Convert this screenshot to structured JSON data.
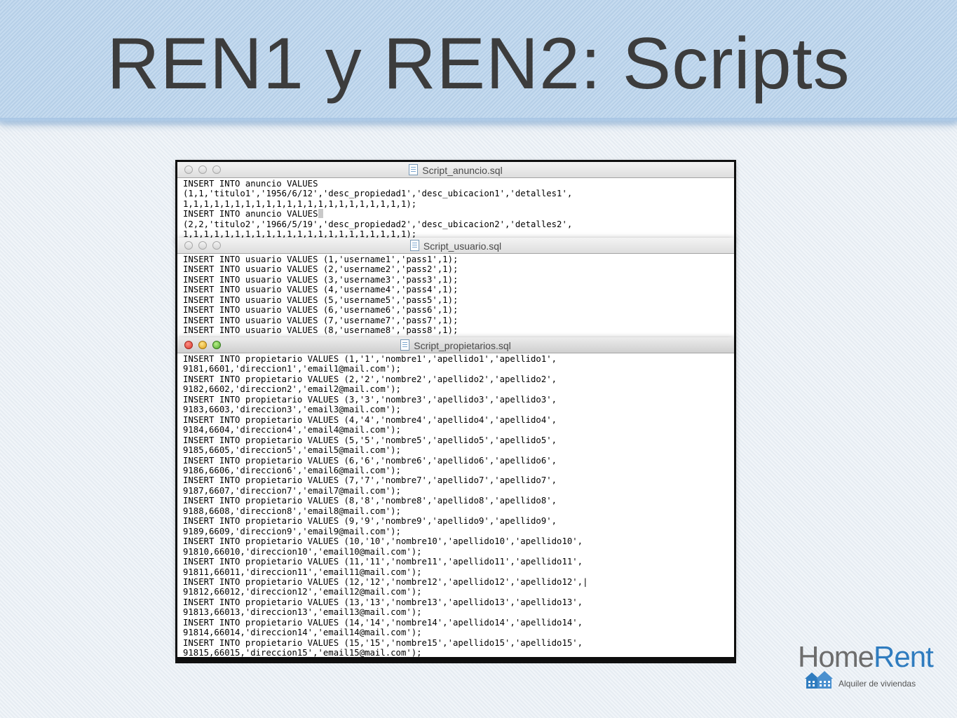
{
  "slide": {
    "title": "REN1 y REN2: Scripts"
  },
  "windows": [
    {
      "title": "Script_anuncio.sql",
      "active": false,
      "lines": [
        "INSERT INTO anuncio VALUES",
        "(1,1,'titulo1','1956/6/12','desc_propiedad1','desc_ubicacion1','detalles1',",
        "1,1,1,1,1,1,1,1,1,1,1,1,1,1,1,1,1,1,1,1,1,1);",
        "INSERT INTO anuncio VALUES",
        "(2,2,'titulo2','1966/5/19','desc_propiedad2','desc_ubicacion2','detalles2',",
        "1,1,1,1,1,1,1,1,1,1,1,1,1,1,1,1,1,1,1,1,1,1);"
      ]
    },
    {
      "title": "Script_usuario.sql",
      "active": false,
      "lines": [
        "INSERT INTO usuario VALUES (1,'username1','pass1',1);",
        "INSERT INTO usuario VALUES (2,'username2','pass2',1);",
        "INSERT INTO usuario VALUES (3,'username3','pass3',1);",
        "INSERT INTO usuario VALUES (4,'username4','pass4',1);",
        "INSERT INTO usuario VALUES (5,'username5','pass5',1);",
        "INSERT INTO usuario VALUES (6,'username6','pass6',1);",
        "INSERT INTO usuario VALUES (7,'username7','pass7',1);",
        "INSERT INTO usuario VALUES (8,'username8','pass8',1);"
      ]
    },
    {
      "title": "Script_propietarios.sql",
      "active": true,
      "lines": [
        "INSERT INTO propietario VALUES (1,'1','nombre1','apellido1','apellido1',",
        "9181,6601,'direccion1','email1@mail.com');",
        "INSERT INTO propietario VALUES (2,'2','nombre2','apellido2','apellido2',",
        "9182,6602,'direccion2','email2@mail.com');",
        "INSERT INTO propietario VALUES (3,'3','nombre3','apellido3','apellido3',",
        "9183,6603,'direccion3','email3@mail.com');",
        "INSERT INTO propietario VALUES (4,'4','nombre4','apellido4','apellido4',",
        "9184,6604,'direccion4','email4@mail.com');",
        "INSERT INTO propietario VALUES (5,'5','nombre5','apellido5','apellido5',",
        "9185,6605,'direccion5','email5@mail.com');",
        "INSERT INTO propietario VALUES (6,'6','nombre6','apellido6','apellido6',",
        "9186,6606,'direccion6','email6@mail.com');",
        "INSERT INTO propietario VALUES (7,'7','nombre7','apellido7','apellido7',",
        "9187,6607,'direccion7','email7@mail.com');",
        "INSERT INTO propietario VALUES (8,'8','nombre8','apellido8','apellido8',",
        "9188,6608,'direccion8','email8@mail.com');",
        "INSERT INTO propietario VALUES (9,'9','nombre9','apellido9','apellido9',",
        "9189,6609,'direccion9','email9@mail.com');",
        "INSERT INTO propietario VALUES (10,'10','nombre10','apellido10','apellido10',",
        "91810,66010,'direccion10','email10@mail.com');",
        "INSERT INTO propietario VALUES (11,'11','nombre11','apellido11','apellido11',",
        "91811,66011,'direccion11','email11@mail.com');",
        "INSERT INTO propietario VALUES (12,'12','nombre12','apellido12','apellido12',",
        "91812,66012,'direccion12','email12@mail.com');",
        "INSERT INTO propietario VALUES (13,'13','nombre13','apellido13','apellido13',",
        "91813,66013,'direccion13','email13@mail.com');",
        "INSERT INTO propietario VALUES (14,'14','nombre14','apellido14','apellido14',",
        "91814,66014,'direccion14','email14@mail.com');",
        "INSERT INTO propietario VALUES (15,'15','nombre15','apellido15','apellido15',",
        "91815,66015,'direccion15','email15@mail.com');"
      ]
    }
  ],
  "logo": {
    "brand_part1": "Home",
    "brand_part2": "Rent",
    "tagline": "Alquiler de viviendas",
    "colors": {
      "home": "#6d6d6d",
      "rent": "#2f7cbf"
    }
  }
}
